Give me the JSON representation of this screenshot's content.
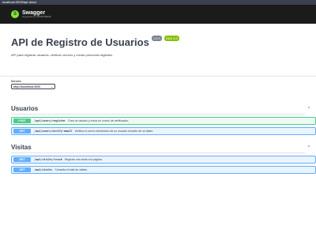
{
  "browser": {
    "tab_title": "localhost:3000/api-docs/"
  },
  "topbar": {
    "logo_glyph": "S",
    "logo_title": "Swagger",
    "logo_sub": "supported by SMARTBEAR"
  },
  "info": {
    "title": "API de Registro de Usuarios",
    "version": "1.0.0",
    "oas": "OAS 3.0",
    "description": "API para registrar usuarios, verificar correos y enviar productos digitales."
  },
  "servers": {
    "label": "Servers",
    "selected": "http://localhost:3000",
    "chevron": "⌄"
  },
  "tags": [
    {
      "name": "Usuarios",
      "chevron": "^",
      "operations": [
        {
          "method": "POST",
          "path": "/api/users/register",
          "summary": "Crea un usuario y envía un correo de verificación."
        },
        {
          "method": "GET",
          "path": "/api/users/verify-email",
          "summary": "Verifica el correo electrónico de un usuario a través de un token."
        }
      ]
    },
    {
      "name": "Visitas",
      "chevron": "^",
      "operations": [
        {
          "method": "GET",
          "path": "/api/visits/track",
          "summary": "Registra una visita a la página."
        },
        {
          "method": "GET",
          "path": "/api/visits",
          "summary": "Consulta el total de visitas."
        }
      ]
    }
  ],
  "colors": {
    "post": "#49cc90",
    "get": "#61affe",
    "topbar": "#1b1b1b",
    "accent": "#89bf04"
  }
}
